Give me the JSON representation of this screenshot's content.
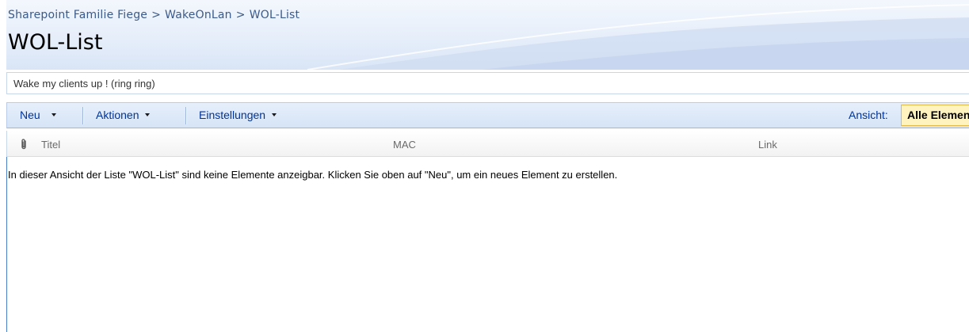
{
  "breadcrumb": {
    "site": "Sharepoint Familie Fiege",
    "separator": ">",
    "list_parent": "WakeOnLan",
    "current": "WOL-List"
  },
  "page_title": "WOL-List",
  "description": "Wake my clients up ! (ring ring)",
  "toolbar": {
    "new_label": "Neu",
    "actions_label": "Aktionen",
    "settings_label": "Einstellungen",
    "view_label": "Ansicht:",
    "view_value": "Alle Elemente"
  },
  "columns": {
    "attachment_icon": "paperclip-icon",
    "title": "Titel",
    "mac": "MAC",
    "link": "Link"
  },
  "empty_message": "In dieser Ansicht der Liste \"WOL-List\" sind keine Elemente anzeigbar. Klicken Sie oben auf \"Neu\", um ein neues Element zu erstellen.",
  "colors": {
    "link": "#003399",
    "breadcrumb": "#3b5a8a",
    "view_highlight": "#fff3c0"
  }
}
